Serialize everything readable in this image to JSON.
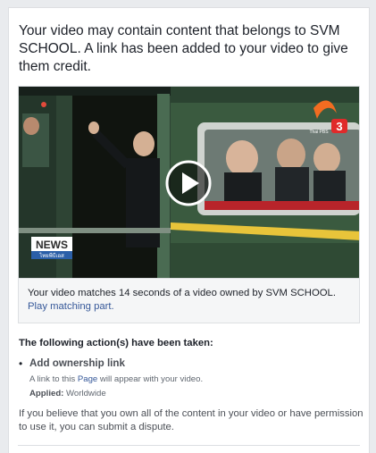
{
  "notice": {
    "headline": "Your video may contain content that belongs to SVM SCHOOL. A link has been added to your video to give them credit."
  },
  "video": {
    "news_badge": "NEWS",
    "news_badge_sub": "ไทยพีบีเอส",
    "channel_logo": "3",
    "channel_logo_sub": "Thai PBS",
    "play_icon": "play-icon"
  },
  "match": {
    "text": "Your video matches 14 seconds of a video owned by SVM SCHOOL.",
    "link": "Play matching part."
  },
  "actions": {
    "title": "The following action(s) have been taken:",
    "items": [
      {
        "name": "Add ownership link",
        "desc_prefix": "A link to this ",
        "desc_link": "Page",
        "desc_suffix": " will appear with your video.",
        "applied_label": "Applied:",
        "applied_value": " Worldwide"
      }
    ]
  },
  "dispute": {
    "text": "If you believe that you own all of the content in your video or have permission to use it, you can submit a dispute."
  },
  "colors": {
    "link": "#365899",
    "train": "#3a5a3f",
    "stripe": "#e8c43a"
  }
}
